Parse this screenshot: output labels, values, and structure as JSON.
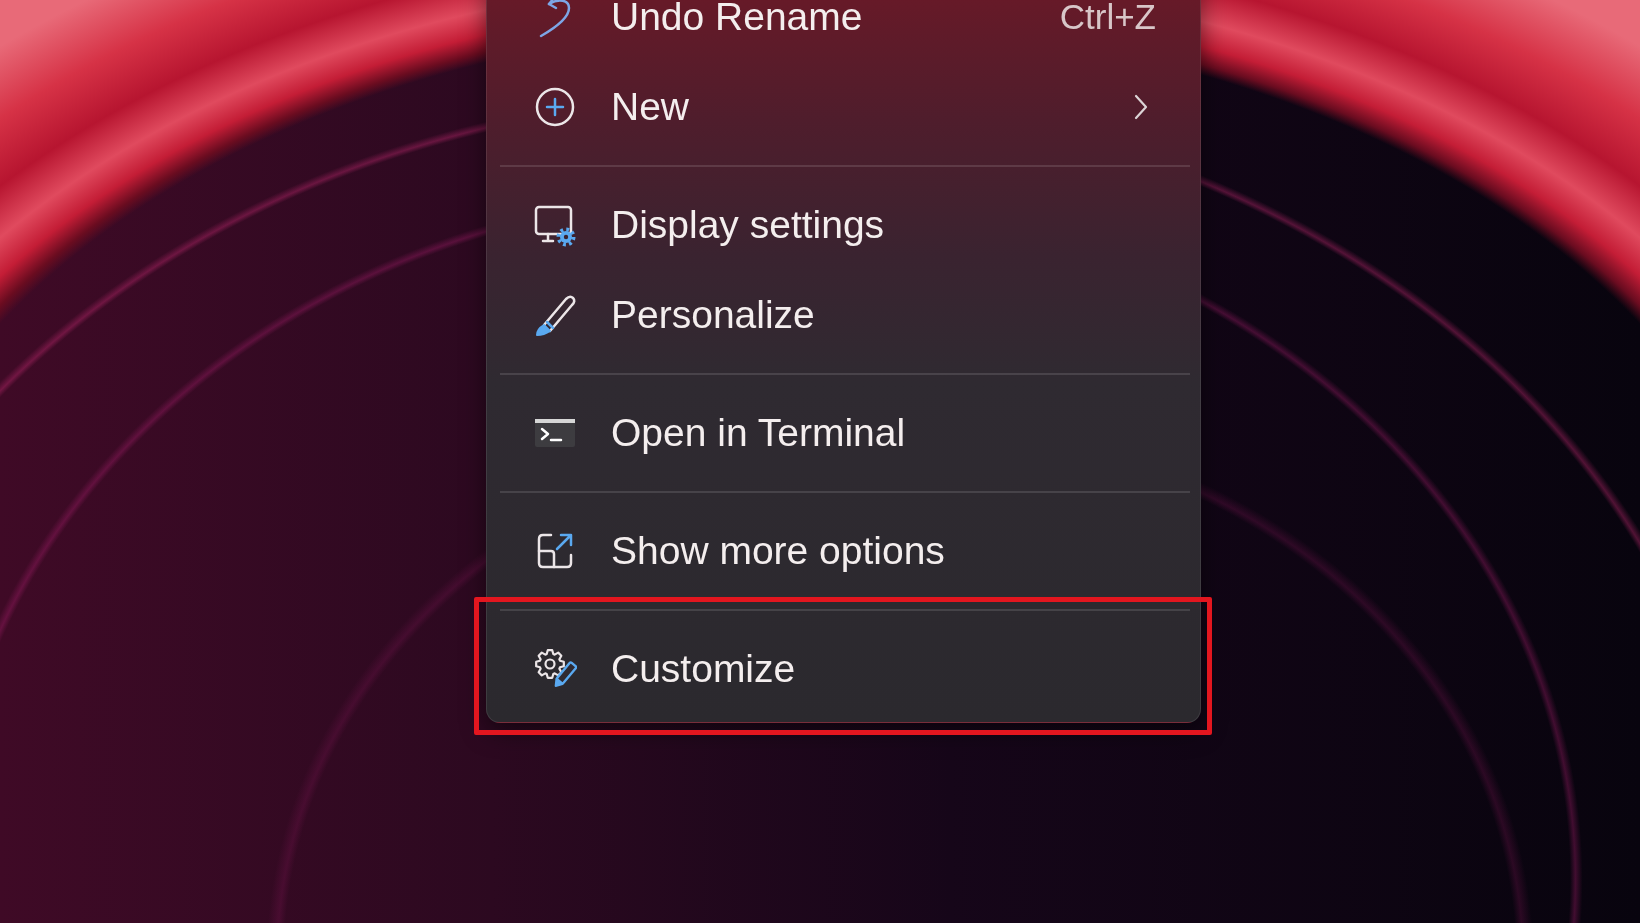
{
  "context_menu": {
    "sections": [
      {
        "items": [
          {
            "label": "Undo Rename",
            "shortcut": "Ctrl+Z",
            "submenu": false,
            "highlighted": false
          },
          {
            "label": "New",
            "submenu": true,
            "highlighted": false
          }
        ]
      },
      {
        "items": [
          {
            "label": "Display settings",
            "submenu": false,
            "highlighted": false
          },
          {
            "label": "Personalize",
            "submenu": false,
            "highlighted": false
          }
        ]
      },
      {
        "items": [
          {
            "label": "Open in Terminal",
            "submenu": false,
            "highlighted": false
          }
        ]
      },
      {
        "items": [
          {
            "label": "Show more options",
            "submenu": false,
            "highlighted": false
          }
        ]
      },
      {
        "items": [
          {
            "label": "Customize",
            "submenu": false,
            "highlighted": true
          }
        ]
      }
    ]
  }
}
